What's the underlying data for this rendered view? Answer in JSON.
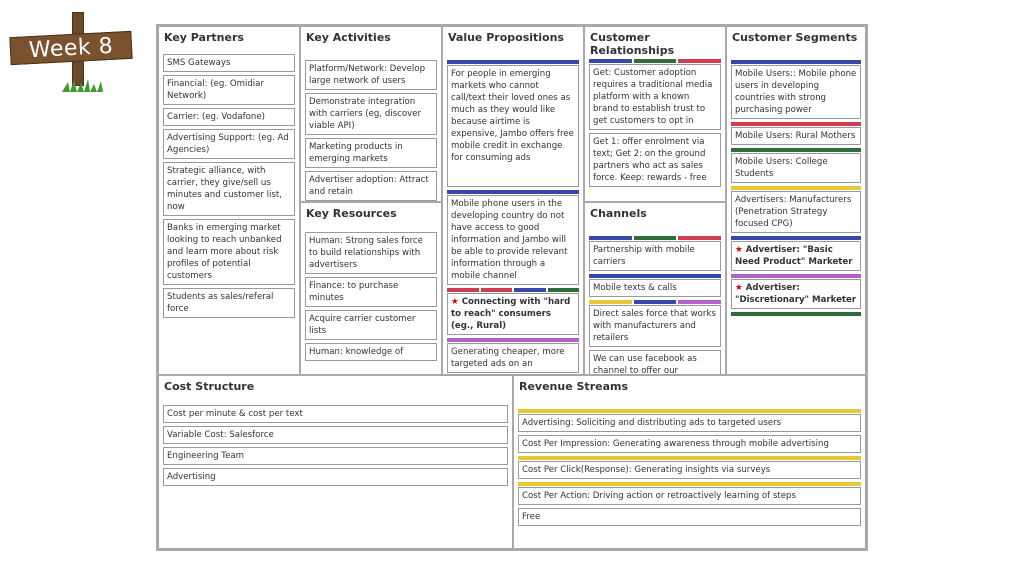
{
  "sign": {
    "label": "Week 8"
  },
  "colors": {
    "blue": "#3848a8",
    "red": "#d23c50",
    "green": "#2e6e3c",
    "yellow": "#e8c838",
    "purple": "#b463c8",
    "star": "#d40000"
  },
  "key_partners": {
    "title": "Key Partners",
    "cards": [
      "SMS Gateways",
      "Financial: (eg. Omidiar Network)",
      "Carrier: (eg. Vodafone)",
      "Advertising Support: (eg. Ad Agencies)",
      "Strategic alliance, with carrier, they give/sell us minutes and customer list, now",
      "Banks in emerging market looking to reach unbanked and learn more about risk profiles of potential customers",
      "Students as sales/referal force"
    ]
  },
  "key_activities": {
    "title": "Key Activities",
    "cards": [
      "Platform/Network: Develop large network of users",
      "Demonstrate integration with carriers (eg, discover viable API)",
      "Marketing products in emerging markets",
      "Advertiser adoption: Attract and retain"
    ]
  },
  "key_resources": {
    "title": "Key Resources",
    "cards": [
      "Human: Strong sales force to build relationships with advertisers",
      "Finance: to purchase minutes",
      "Acquire carrier customer lists",
      "Human: knowledge of"
    ]
  },
  "value_propositions": {
    "title": "Value Propositions",
    "cards": [
      "For people in emerging markets who cannot call/text their loved ones as much as they would like because airtime is expensive, Jambo offers free mobile credit in exchange for consuming ads",
      "Mobile phone users in the developing country do not have access to good information and Jambo will be able to provide relevant information through a mobile channel",
      "Connecting with \"hard to reach\" consumers (eg., Rural)",
      "Generating cheaper, more targeted ads on an"
    ]
  },
  "customer_relationships": {
    "title": "Customer Relationships",
    "cards": [
      "Get: Customer adoption requires a traditional media platform with a known brand to establish trust to get customers to opt in",
      "Get 1: offer enrolment via text; Get 2: on the ground partners who act as sales force. Keep: rewards - free"
    ]
  },
  "channels": {
    "title": "Channels",
    "cards": [
      "Partnership with mobile carriers",
      "Mobile texts & calls",
      "Direct sales force that works with manufacturers and retailers",
      "We can use facebook as channel to offer our"
    ]
  },
  "customer_segments": {
    "title": "Customer Segments",
    "cards": [
      "Mobile Users:: Mobile phone users in developing countries with strong purchasing power",
      "Mobile Users: Rural Mothers",
      "Mobile Users: College Students",
      "Advertisers: Manufacturers (Penetration Strategy focused CPG)",
      "Advertiser: \"Basic Need Product\" Marketer",
      "Advertiser: \"Discretionary\" Marketer"
    ]
  },
  "cost_structure": {
    "title": "Cost Structure",
    "cards": [
      "Cost per minute & cost per text",
      "Variable Cost: Salesforce",
      "Engineering Team",
      "Advertising"
    ]
  },
  "revenue_streams": {
    "title": "Revenue Streams",
    "cards": [
      "Advertising: Soliciting and distributing ads to targeted users",
      "Cost Per Impression: Generating awareness through mobile advertising",
      "Cost Per Click(Response): Generating insights via surveys",
      "Cost Per Action: Driving action or retroactively learning of steps",
      "Free"
    ]
  }
}
